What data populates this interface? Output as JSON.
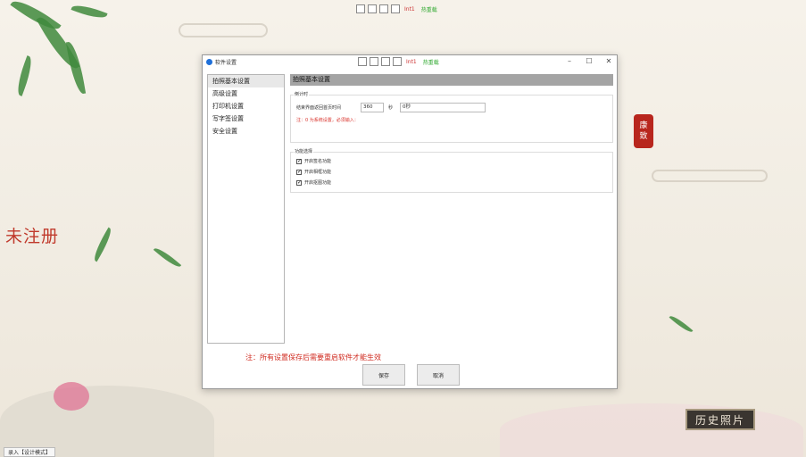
{
  "background": {
    "unregistered_text": "未注册",
    "seal_chars": [
      "康",
      "致"
    ],
    "history_button": "历史照片",
    "status_text": "录入【设计模式】",
    "top_toolbar": {
      "counter": "Int1",
      "hot_update": "热重载"
    }
  },
  "dialog": {
    "title": "软件设置",
    "toolbar": {
      "counter": "Int1",
      "hot_update": "热重载"
    },
    "controls": {
      "minimize": "–",
      "maximize": "☐",
      "close": "✕"
    },
    "sidebar": {
      "items": [
        {
          "label": "拍照基本设置",
          "active": true
        },
        {
          "label": "高级设置",
          "active": false
        },
        {
          "label": "打印机设置",
          "active": false
        },
        {
          "label": "写字签设置",
          "active": false
        },
        {
          "label": "安全设置",
          "active": false
        }
      ]
    },
    "content": {
      "header": "拍照基本设置",
      "countdown": {
        "group_title": "倒计时",
        "label": "结束界面返回首页时间",
        "value": "360",
        "unit": "秒",
        "text_value": "0秒",
        "note": "注：0 为系统设置，必须输入："
      },
      "features": {
        "group_title": "功能选择",
        "options": [
          {
            "label": "开启签名功能",
            "checked": true
          },
          {
            "label": "开启相框功能",
            "checked": true
          },
          {
            "label": "开启抠图功能",
            "checked": true
          }
        ]
      }
    },
    "footer_note": "注：所有设置保存后需要重启软件才能生效",
    "buttons": {
      "save": "保存",
      "cancel": "取消"
    }
  }
}
